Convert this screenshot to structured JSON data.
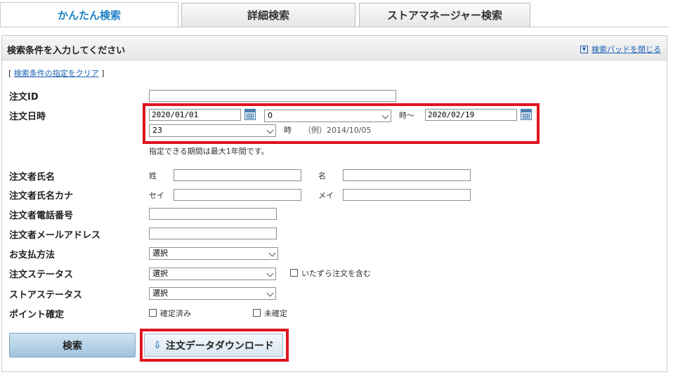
{
  "tabs": [
    {
      "label": "かんたん検索",
      "active": true
    },
    {
      "label": "詳細検索",
      "active": false
    },
    {
      "label": "ストアマネージャー検索",
      "active": false
    }
  ],
  "panel": {
    "title": "検索条件を入力してください",
    "close_pad": "検索パッドを閉じる",
    "clear_prefix": "[ ",
    "clear_link": "検索条件の指定をクリア",
    "clear_suffix": " ]"
  },
  "fields": {
    "order_id": {
      "label": "注文ID",
      "value": ""
    },
    "order_datetime": {
      "label": "注文日時",
      "from_date": "2020/01/01",
      "from_hour": "0",
      "from_suffix": "時～",
      "to_date": "2020/02/19",
      "to_hour": "23",
      "to_suffix": "時",
      "example": "（例）2014/10/05",
      "note": "指定できる期間は最大1年間です。"
    },
    "orderer_name": {
      "label": "注文者氏名",
      "sei_label": "姓",
      "mei_label": "名",
      "sei": "",
      "mei": ""
    },
    "orderer_kana": {
      "label": "注文者氏名カナ",
      "sei_label": "セイ",
      "mei_label": "メイ",
      "sei": "",
      "mei": ""
    },
    "phone": {
      "label": "注文者電話番号",
      "value": ""
    },
    "email": {
      "label": "注文者メールアドレス",
      "value": ""
    },
    "payment": {
      "label": "お支払方法",
      "selected": "選択"
    },
    "order_status": {
      "label": "注文ステータス",
      "selected": "選択",
      "prank_label": "いたずら注文を含む",
      "prank_checked": false
    },
    "store_status": {
      "label": "ストアステータス",
      "selected": "選択"
    },
    "points": {
      "label": "ポイント確定",
      "confirmed_label": "確定済み",
      "unconfirmed_label": "未確定",
      "confirmed": false,
      "unconfirmed": false
    }
  },
  "buttons": {
    "search": "検索",
    "download": "注文データダウンロード"
  },
  "icons": {
    "calendar": "calendar-icon",
    "download": "download-icon",
    "dropdown": "chevron-down-icon",
    "pad_toggle": "triangle-down-icon"
  },
  "colors": {
    "active_tab_text": "#1b7fc4",
    "link": "#1a5fb4",
    "highlight": "#e0141e",
    "search_button": "#9fc3de"
  }
}
